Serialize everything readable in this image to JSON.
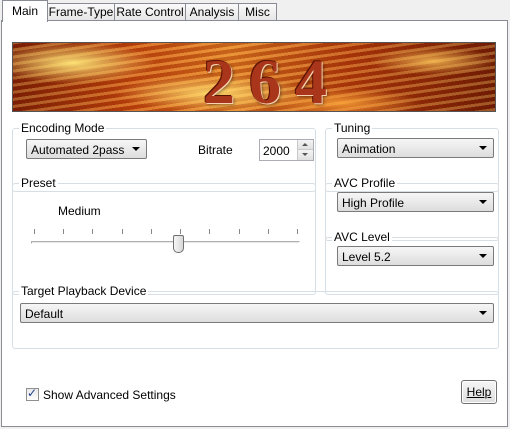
{
  "tabs": [
    "Main",
    "Frame-Type",
    "Rate Control",
    "Analysis",
    "Misc"
  ],
  "banner": {
    "text": "264"
  },
  "encoding_mode": {
    "label": "Encoding Mode",
    "value": "Automated 2pass"
  },
  "bitrate": {
    "label": "Bitrate",
    "value": "2000"
  },
  "tuning": {
    "label": "Tuning",
    "value": "Animation"
  },
  "preset": {
    "label": "Preset",
    "value_label": "Medium",
    "level": 0.545
  },
  "avc_profile": {
    "label": "AVC Profile",
    "value": "High Profile"
  },
  "avc_level": {
    "label": "AVC Level",
    "value": "Level 5.2"
  },
  "target_device": {
    "label": "Target Playback Device",
    "value": "Default"
  },
  "show_advanced": {
    "label": "Show Advanced Settings",
    "checked": true
  },
  "help": {
    "label": "Help"
  }
}
